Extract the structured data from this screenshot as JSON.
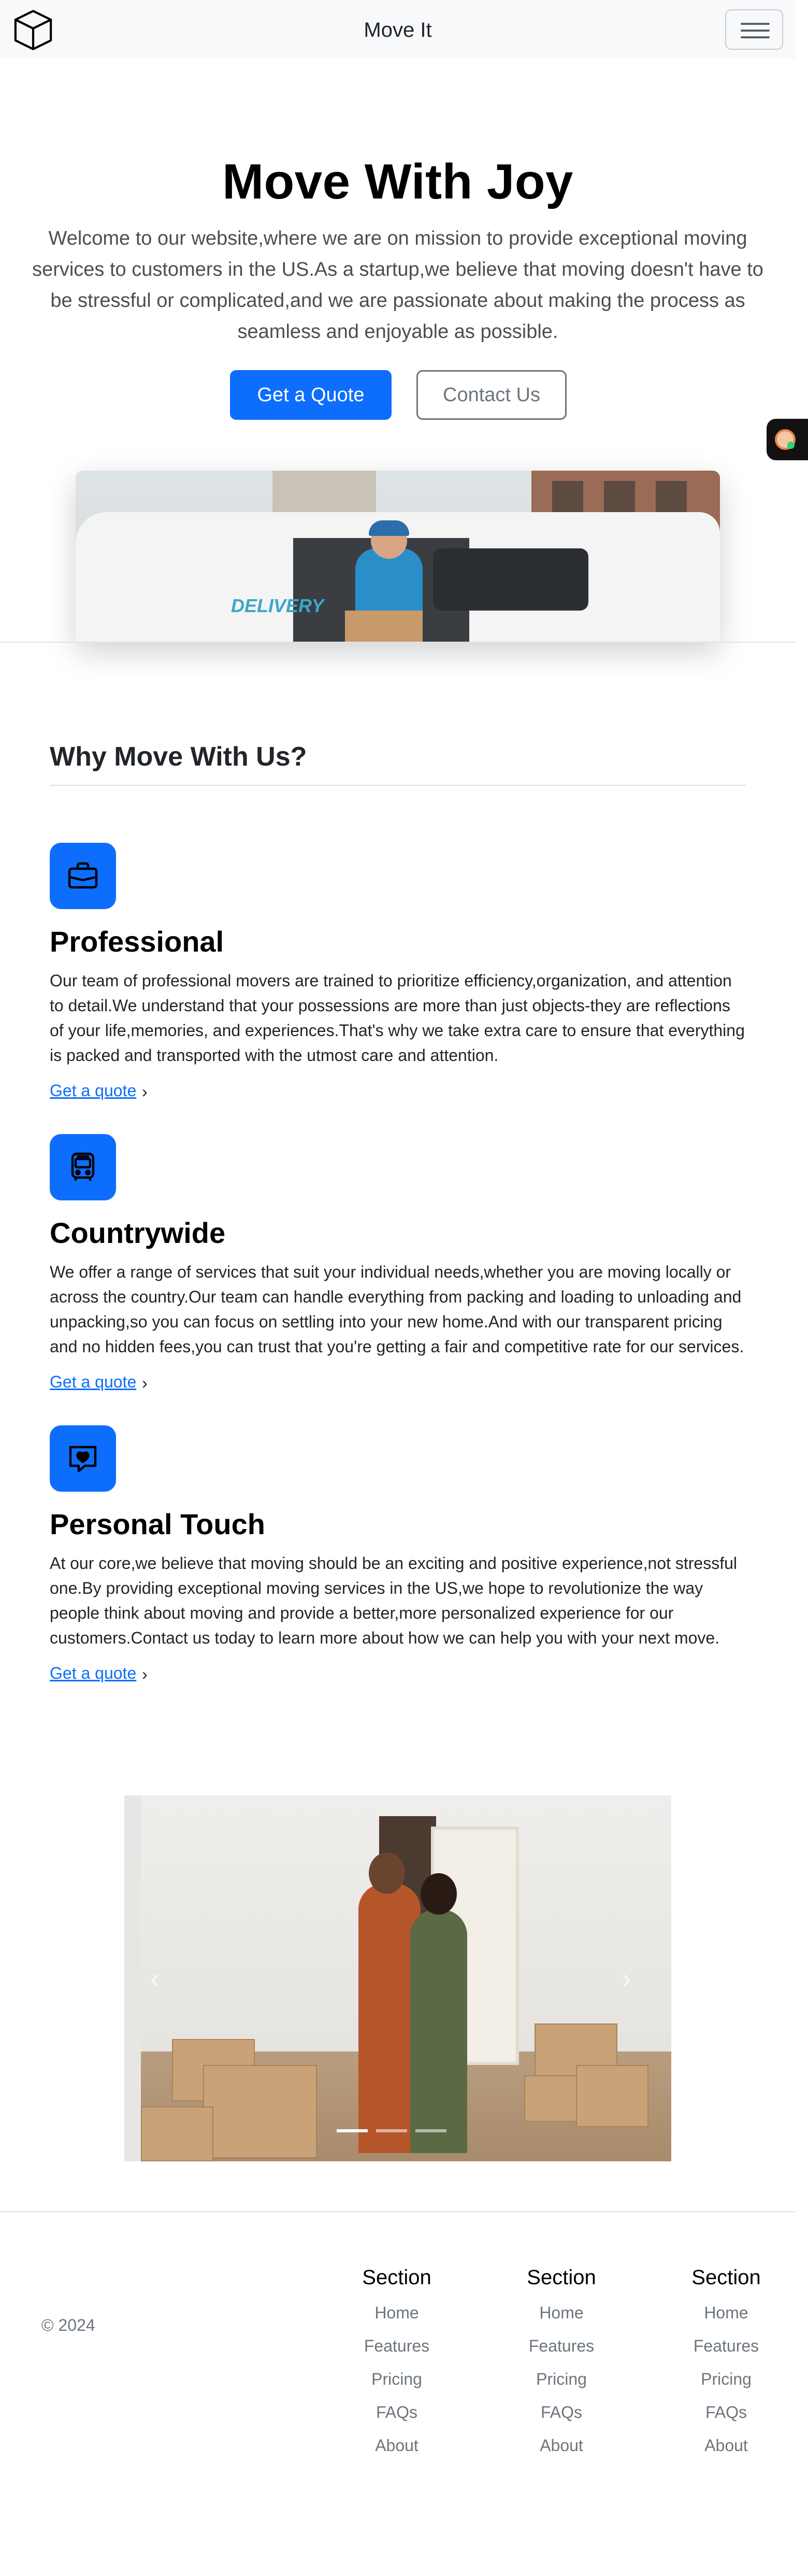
{
  "navbar": {
    "brand_name": "Move It",
    "logo_icon": "cube-icon",
    "toggler_icon": "hamburger-menu-icon"
  },
  "hero": {
    "title": "Move With Joy",
    "lead": "Welcome to our website,where we are on mission to provide exceptional moving services to customers in the US.As a startup,we believe that moving doesn't have to be stressful or complicated,and we are passionate about making the process as seamless and enjoyable as possible.",
    "primary_button": "Get a Quote",
    "secondary_button": "Contact Us",
    "image_text": "DELIVERY",
    "image_alt_icon": "delivery-van-image"
  },
  "features": {
    "title": "Why Move With Us?",
    "items": [
      {
        "icon": "briefcase-icon",
        "title": "Professional",
        "text": "Our team of professional movers are trained to prioritize efficiency,organization, and attention to detail.We understand that your possessions are more than just objects-they are reflections of your life,memories, and experiences.That's why we take extra care to ensure that everything is packed and transported with the utmost care and attention.",
        "link": "Get a quote"
      },
      {
        "icon": "bus-icon",
        "title": "Countrywide",
        "text": "We offer a range of services that suit your individual needs,whether you are moving locally or across the country.Our team can handle everything from packing and loading to unloading and unpacking,so you can focus on settling into your new home.And with our transparent pricing and no hidden fees,you can trust that you're getting a fair and competitive rate for our services.",
        "link": "Get a quote"
      },
      {
        "icon": "chat-heart-icon",
        "title": "Personal Touch",
        "text": "At our core,we believe that moving should be an exciting and positive experience,not stressful one.By providing exceptional moving services in the US,we hope to revolutionize the way people think about moving and provide a better,more personalized experience for our customers.Contact us today to learn more about how we can help you with your next move.",
        "link": "Get a quote"
      }
    ],
    "chevron": "›"
  },
  "carousel": {
    "prev_icon": "chevron-left-icon",
    "next_icon": "chevron-right-icon",
    "prev_glyph": "‹",
    "next_glyph": "›",
    "active_index": 0,
    "slide_count": 3
  },
  "footer": {
    "copyright": "© 2024",
    "columns": [
      {
        "heading": "Section",
        "links": [
          "Home",
          "Features",
          "Pricing",
          "FAQs",
          "About"
        ]
      },
      {
        "heading": "Section",
        "links": [
          "Home",
          "Features",
          "Pricing",
          "FAQs",
          "About"
        ]
      },
      {
        "heading": "Section",
        "links": [
          "Home",
          "Features",
          "Pricing",
          "FAQs",
          "About"
        ]
      }
    ]
  },
  "colors": {
    "primary": "#0d6efd",
    "secondary": "#6c757d",
    "nav_bg": "#f8f9fa",
    "text": "#212529"
  }
}
